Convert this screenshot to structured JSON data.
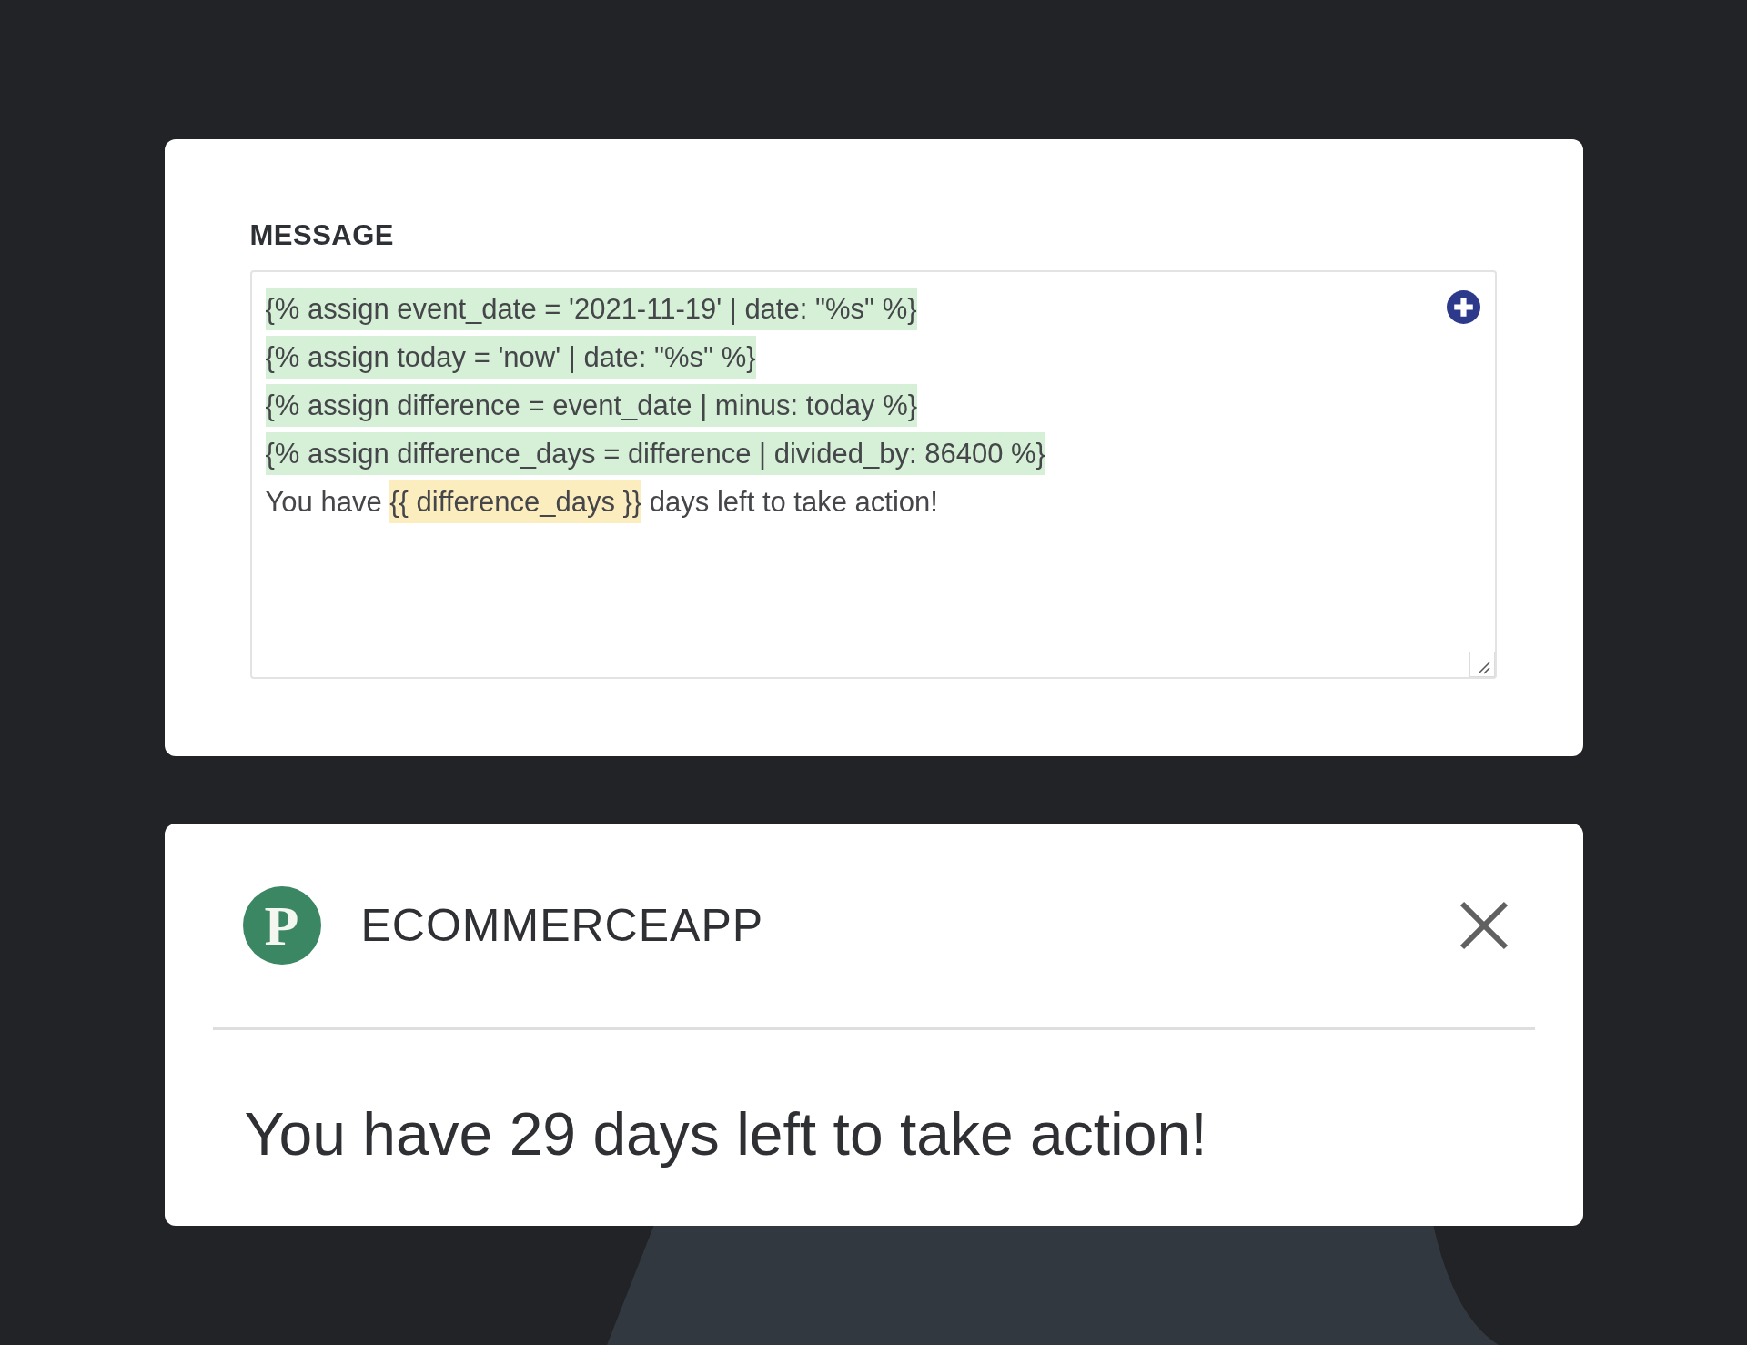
{
  "editor": {
    "label": "MESSAGE",
    "lines": [
      [
        {
          "kind": "tag",
          "text": "{% assign event_date = '2021-11-19' | date: \"%s\" %}"
        }
      ],
      [
        {
          "kind": "tag",
          "text": "{% assign today = 'now' | date: \"%s\" %}"
        }
      ],
      [
        {
          "kind": "tag",
          "text": "{% assign difference = event_date | minus: today %}"
        }
      ],
      [
        {
          "kind": "tag",
          "text": "{% assign difference_days = difference | divided_by: 86400 %}"
        }
      ],
      [
        {
          "kind": "text",
          "text": "You have "
        },
        {
          "kind": "variable",
          "text": "{{ difference_days }}"
        },
        {
          "kind": "text",
          "text": " days left to take action!"
        }
      ]
    ]
  },
  "notification": {
    "logo_letter": "P",
    "app_name": "ECOMMERCEAPP",
    "message": "You have 29 days left to take action!"
  }
}
